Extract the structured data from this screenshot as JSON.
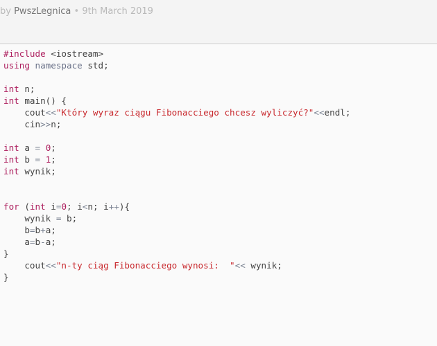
{
  "header": {
    "by_label": "by",
    "author": "PwszLegnica",
    "separator": "•",
    "date": "9th March 2019"
  },
  "code": {
    "language": "cpp",
    "lines": [
      [
        {
          "t": "kw",
          "v": "#include"
        },
        {
          "t": "p",
          "v": " <iostream>"
        }
      ],
      [
        {
          "t": "kw",
          "v": "using"
        },
        {
          "t": "p",
          "v": " "
        },
        {
          "t": "ns",
          "v": "namespace"
        },
        {
          "t": "p",
          "v": " std;"
        }
      ],
      [],
      [
        {
          "t": "kw",
          "v": "int"
        },
        {
          "t": "p",
          "v": " n;"
        }
      ],
      [
        {
          "t": "kw",
          "v": "int"
        },
        {
          "t": "p",
          "v": " main() {"
        }
      ],
      [
        {
          "t": "p",
          "v": "    cout"
        },
        {
          "t": "op",
          "v": "<<"
        },
        {
          "t": "str",
          "v": "\"Który wyraz ciągu Fibonacciego chcesz wyliczyć?\""
        },
        {
          "t": "op",
          "v": "<<"
        },
        {
          "t": "p",
          "v": "endl;"
        }
      ],
      [
        {
          "t": "p",
          "v": "    cin"
        },
        {
          "t": "op",
          "v": ">>"
        },
        {
          "t": "p",
          "v": "n;"
        }
      ],
      [],
      [
        {
          "t": "kw",
          "v": "int"
        },
        {
          "t": "p",
          "v": " a "
        },
        {
          "t": "op",
          "v": "="
        },
        {
          "t": "p",
          "v": " "
        },
        {
          "t": "num",
          "v": "0"
        },
        {
          "t": "p",
          "v": ";"
        }
      ],
      [
        {
          "t": "kw",
          "v": "int"
        },
        {
          "t": "p",
          "v": " b "
        },
        {
          "t": "op",
          "v": "="
        },
        {
          "t": "p",
          "v": " "
        },
        {
          "t": "num",
          "v": "1"
        },
        {
          "t": "p",
          "v": ";"
        }
      ],
      [
        {
          "t": "kw",
          "v": "int"
        },
        {
          "t": "p",
          "v": " wynik;"
        }
      ],
      [],
      [],
      [
        {
          "t": "kw",
          "v": "for"
        },
        {
          "t": "p",
          "v": " ("
        },
        {
          "t": "kw",
          "v": "int"
        },
        {
          "t": "p",
          "v": " i"
        },
        {
          "t": "op",
          "v": "="
        },
        {
          "t": "num",
          "v": "0"
        },
        {
          "t": "p",
          "v": "; i"
        },
        {
          "t": "op",
          "v": "<"
        },
        {
          "t": "p",
          "v": "n; i"
        },
        {
          "t": "op",
          "v": "++"
        },
        {
          "t": "p",
          "v": "){"
        }
      ],
      [
        {
          "t": "p",
          "v": "    wynik "
        },
        {
          "t": "op",
          "v": "="
        },
        {
          "t": "p",
          "v": " b;"
        }
      ],
      [
        {
          "t": "p",
          "v": "    b"
        },
        {
          "t": "op",
          "v": "="
        },
        {
          "t": "p",
          "v": "b"
        },
        {
          "t": "op",
          "v": "+"
        },
        {
          "t": "p",
          "v": "a;"
        }
      ],
      [
        {
          "t": "p",
          "v": "    a"
        },
        {
          "t": "op",
          "v": "="
        },
        {
          "t": "p",
          "v": "b"
        },
        {
          "t": "op",
          "v": "-"
        },
        {
          "t": "p",
          "v": "a;"
        }
      ],
      [
        {
          "t": "p",
          "v": "}"
        }
      ],
      [
        {
          "t": "p",
          "v": "    cout"
        },
        {
          "t": "op",
          "v": "<<"
        },
        {
          "t": "str",
          "v": "\"n-ty ciąg Fibonacciego wynosi:  \""
        },
        {
          "t": "op",
          "v": "<<"
        },
        {
          "t": "p",
          "v": " wynik;"
        }
      ],
      [
        {
          "t": "p",
          "v": "}"
        }
      ]
    ]
  }
}
